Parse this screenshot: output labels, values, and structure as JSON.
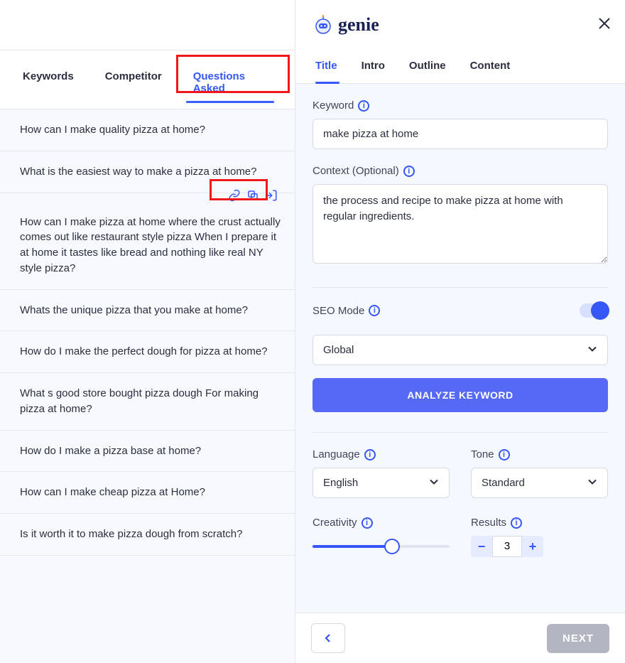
{
  "brand": "genie",
  "left_tabs": {
    "items": [
      "Keywords",
      "Competitor",
      "Questions Asked"
    ],
    "active_index": 2
  },
  "questions": [
    "How can I make quality pizza at home?",
    "What is the easiest way to make a pizza at home?",
    "How can I make pizza at home where the crust actually comes out like restaurant style pizza When I prepare it at home it tastes like bread and nothing like real NY style pizza?",
    "Whats the unique pizza that you make at home?",
    "How do I make the perfect dough for pizza at home?",
    "What s good store bought pizza dough For making pizza at home?",
    "How do I make a pizza base at home?",
    "How can I make cheap pizza at Home?",
    "Is it worth it to make pizza dough from scratch?"
  ],
  "right_tabs": {
    "items": [
      "Title",
      "Intro",
      "Outline",
      "Content"
    ],
    "active_index": 0
  },
  "form": {
    "keyword_label": "Keyword",
    "keyword_value": "make pizza at home",
    "context_label": "Context (Optional)",
    "context_value": "the process and recipe to make pizza at home with regular ingredients.",
    "seo_label": "SEO Mode",
    "seo_on": true,
    "region": "Global",
    "analyze": "ANALYZE KEYWORD",
    "language_label": "Language",
    "language_value": "English",
    "tone_label": "Tone",
    "tone_value": "Standard",
    "creativity_label": "Creativity",
    "creativity_percent": 58,
    "results_label": "Results",
    "results_value": "3"
  },
  "footer": {
    "next": "NEXT"
  }
}
